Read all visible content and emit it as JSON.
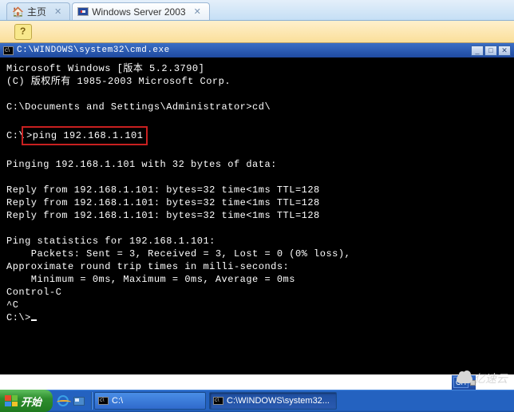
{
  "tabs": [
    {
      "label": "主页",
      "active": false
    },
    {
      "label": "Windows Server 2003",
      "active": true
    }
  ],
  "cmd_window": {
    "title": "C:\\WINDOWS\\system32\\cmd.exe"
  },
  "terminal": {
    "line1": "Microsoft Windows [版本 5.2.3790]",
    "line2": "(C) 版权所有 1985-2003 Microsoft Corp.",
    "blank": "",
    "prompt_cd": "C:\\Documents and Settings\\Administrator>cd\\",
    "highlighted_prefix": "C:\\",
    "highlighted_cmd": ">ping 192.168.1.101",
    "pinging": "Pinging 192.168.1.101 with 32 bytes of data:",
    "reply1": "Reply from 192.168.1.101: bytes=32 time<1ms TTL=128",
    "reply2": "Reply from 192.168.1.101: bytes=32 time<1ms TTL=128",
    "reply3": "Reply from 192.168.1.101: bytes=32 time<1ms TTL=128",
    "stats_hdr": "Ping statistics for 192.168.1.101:",
    "stats_pkt": "    Packets: Sent = 3, Received = 3, Lost = 0 (0% loss),",
    "stats_rtt_hdr": "Approximate round trip times in milli-seconds:",
    "stats_rtt": "    Minimum = 0ms, Maximum = 0ms, Average = 0ms",
    "ctrlc": "Control-C",
    "caret": "^C",
    "final_prompt": "C:\\>"
  },
  "lang_indicator": "CH",
  "watermark": "亿速云",
  "taskbar": {
    "start": "开始",
    "task1": "C:\\",
    "task2": "C:\\WINDOWS\\system32..."
  }
}
